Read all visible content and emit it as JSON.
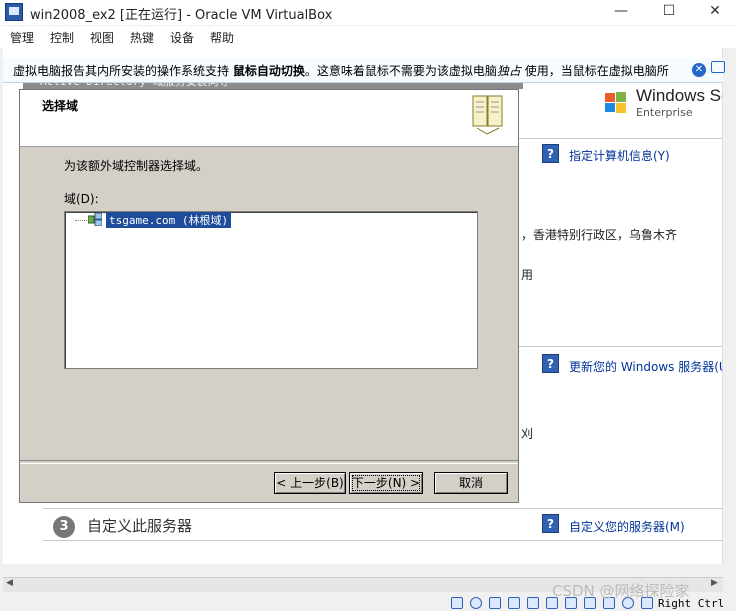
{
  "window": {
    "title": "win2008_ex2 [正在运行] - Oracle VM VirtualBox",
    "minimize": "—",
    "maximize": "☐",
    "close": "✕"
  },
  "menubar": [
    "管理",
    "控制",
    "视图",
    "热键",
    "设备",
    "帮助"
  ],
  "notification": {
    "text_before": "虚拟电脑报告其内所安装的操作系统支持 ",
    "bold": "鼠标自动切换",
    "text_after": "。这意味着鼠标不需要为该虚拟电脑",
    "italic": "独占",
    "text_end": " 使用，当鼠标在虚拟电脑所",
    "close_icon": "✕"
  },
  "server_manager": {
    "logo_text": "Windows Ser",
    "logo_sub": "Enterprise",
    "links": {
      "computer_info": "指定计算机信息(Y)",
      "update": "更新您的 Windows 服务器(U)",
      "customize": "自定义您的服务器(M)"
    },
    "texts": {
      "region": "，香港特别行政区，乌鲁木齐",
      "use": "用",
      "frag": "刈"
    },
    "section_number": "3",
    "section_title": "自定义此服务器"
  },
  "dialog": {
    "caption": "Active Directory 域服务安装向导",
    "caption_close": "✕",
    "title": "选择域",
    "description": "为该额外域控制器选择域。",
    "domain_label": "域(D):",
    "tree_item": "tsgame.com (林根域)",
    "buttons": {
      "back": "< 上一步(B)",
      "next": "下一步(N) >",
      "cancel": "取消"
    }
  },
  "statusbar": {
    "host_key": "Right Ctrl",
    "scroll_left": "◀",
    "scroll_right": "▶"
  },
  "watermark": "CSDN @网络探险家",
  "colors": {
    "selection": "#1e4c9a",
    "link": "#003399",
    "dialog_bg": "#d4d0c8"
  }
}
